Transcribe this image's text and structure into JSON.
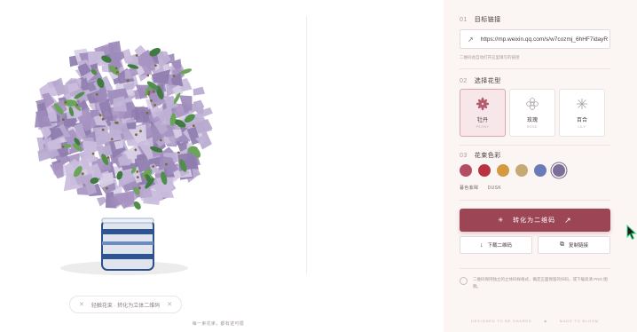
{
  "stage": {
    "hint": "轻触花束 · 转化为立体二维码",
    "caption": "每一束花束，都有迹可循"
  },
  "panel": {
    "link": {
      "num": "01",
      "title": "目标链接",
      "url": "https://mp.weixin.qq.com/s/w7cozmj_6hHF7idayR",
      "hint": "二维码会自动打开这里填写的链接"
    },
    "flower": {
      "num": "02",
      "title": "选择花型",
      "options": [
        {
          "name": "牡丹",
          "sub": "PEONY",
          "icon": "peony-icon"
        },
        {
          "name": "玫瑰",
          "sub": "ROSE",
          "icon": "rose-icon"
        },
        {
          "name": "百合",
          "sub": "LILY",
          "icon": "lily-icon"
        }
      ],
      "selected": "牡丹"
    },
    "color": {
      "num": "03",
      "title": "花束色彩",
      "swatches": [
        "#b34d63",
        "#b8323f",
        "#d49a3f",
        "#c6aa72",
        "#6a7cb8",
        "#7a6f9a"
      ],
      "selected_index": 5,
      "label": "暮色紫眸",
      "label_en": "DUSK"
    },
    "actions": {
      "convert": "转化为二维码",
      "download": "下载二维码",
      "copy": "复制链接"
    },
    "note": "二维码保持独立的立体码样格式，确定正面保留的扫码，或下载高清 PNG 图稿。",
    "footer": {
      "left": "DESIGNED TO BE SHARED",
      "right": "MADE TO BLOOM"
    }
  }
}
